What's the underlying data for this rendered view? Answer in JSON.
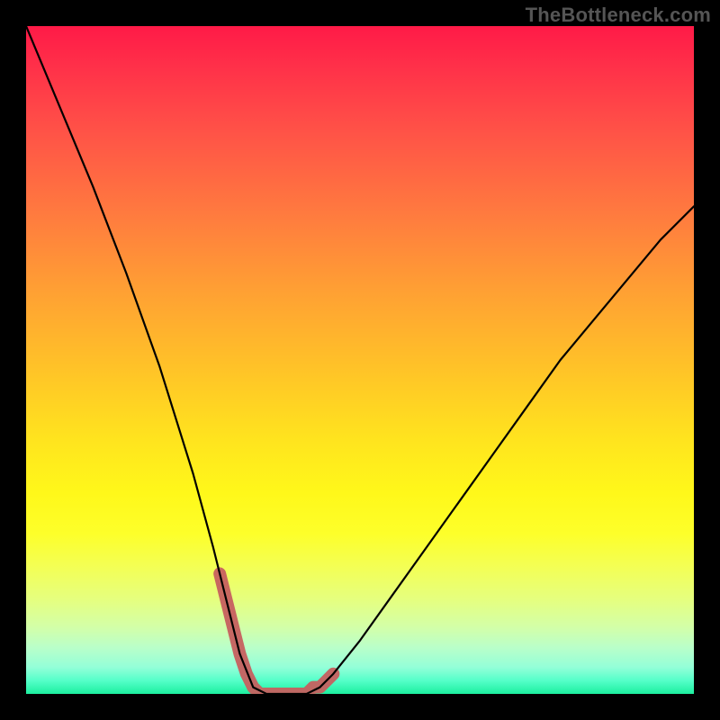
{
  "watermark": {
    "text": "TheBottleneck.com"
  },
  "chart_data": {
    "type": "line",
    "title": "",
    "xlabel": "",
    "ylabel": "",
    "xlim": [
      0,
      100
    ],
    "ylim": [
      0,
      100
    ],
    "series": [
      {
        "name": "bottleneck-curve",
        "x": [
          0,
          5,
          10,
          15,
          20,
          25,
          28,
          30,
          32,
          34,
          36,
          38,
          40,
          42,
          44,
          46,
          50,
          55,
          60,
          65,
          70,
          75,
          80,
          85,
          90,
          95,
          100
        ],
        "values": [
          100,
          88,
          76,
          63,
          49,
          33,
          22,
          14,
          6,
          1,
          0,
          0,
          0,
          0,
          1,
          3,
          8,
          15,
          22,
          29,
          36,
          43,
          50,
          56,
          62,
          68,
          73
        ]
      },
      {
        "name": "sweet-spot-overlay",
        "x": [
          29,
          30,
          31,
          32,
          33,
          34,
          35,
          36,
          37,
          38,
          39,
          40,
          41,
          42,
          43,
          44,
          45,
          46
        ],
        "values": [
          18,
          14,
          10,
          6,
          3,
          1,
          0,
          0,
          0,
          0,
          0,
          0,
          0,
          0,
          1,
          1,
          2,
          3
        ]
      }
    ],
    "annotations": []
  },
  "style": {
    "curve_color": "#000000",
    "overlay_color": "#c6605f",
    "overlay_width": 14
  }
}
